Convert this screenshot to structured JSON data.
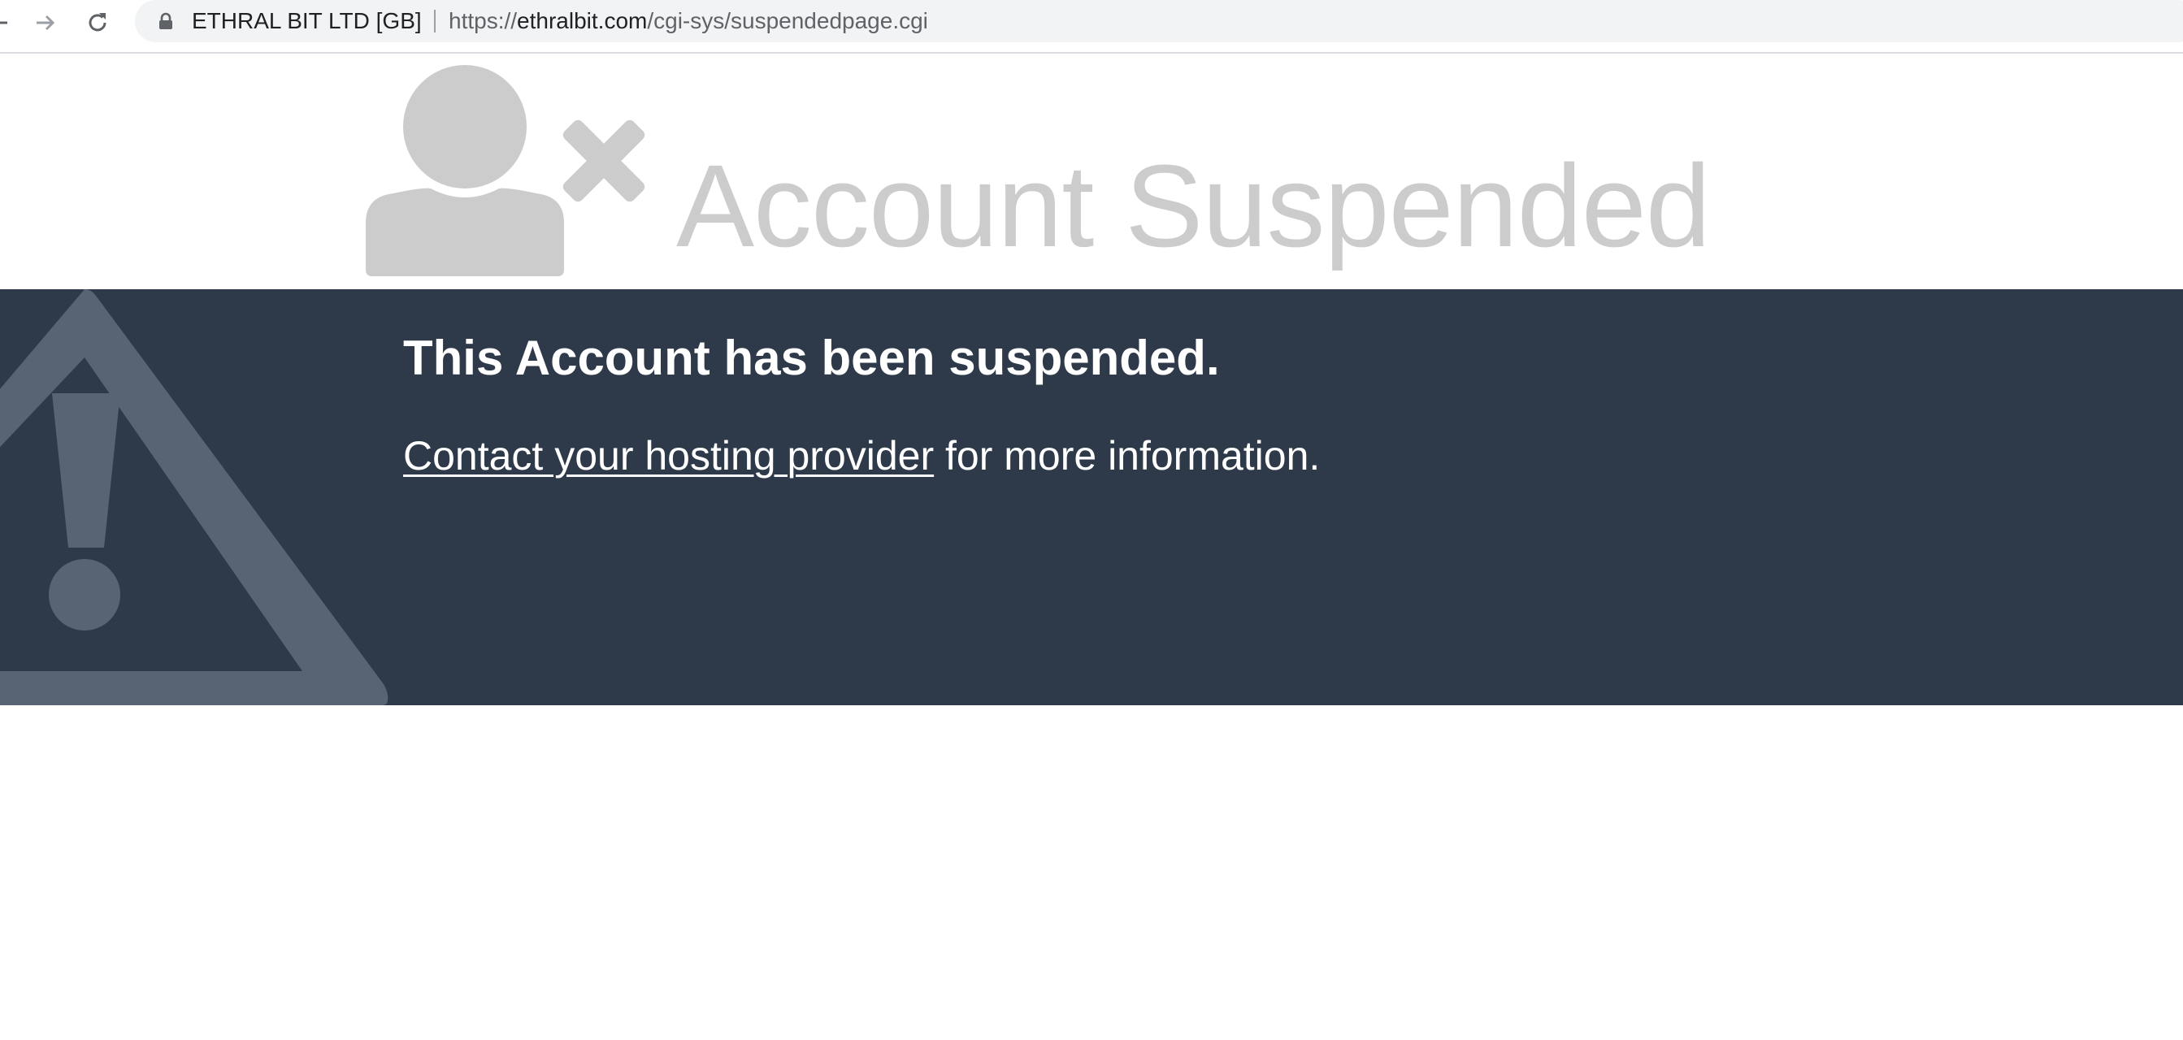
{
  "browser": {
    "certificate_label": "ETHRAL BIT LTD [GB]",
    "url_prefix": "https://",
    "url_host": "ethralbit.com",
    "url_path": "/cgi-sys/suspendedpage.cgi",
    "icons": [
      "back-arrow-icon",
      "forward-arrow-icon",
      "reload-icon",
      "lock-icon"
    ]
  },
  "page": {
    "title": "Account Suspended",
    "headline": "This Account has been suspended.",
    "contact_link": "Contact your hosting provider",
    "contact_suffix": " for more information.",
    "icons": [
      "user-x-icon",
      "warning-triangle-icon"
    ],
    "colors": {
      "band": "#2e3a4a",
      "title": "#cccccc",
      "warning_icon": "#586473"
    }
  }
}
